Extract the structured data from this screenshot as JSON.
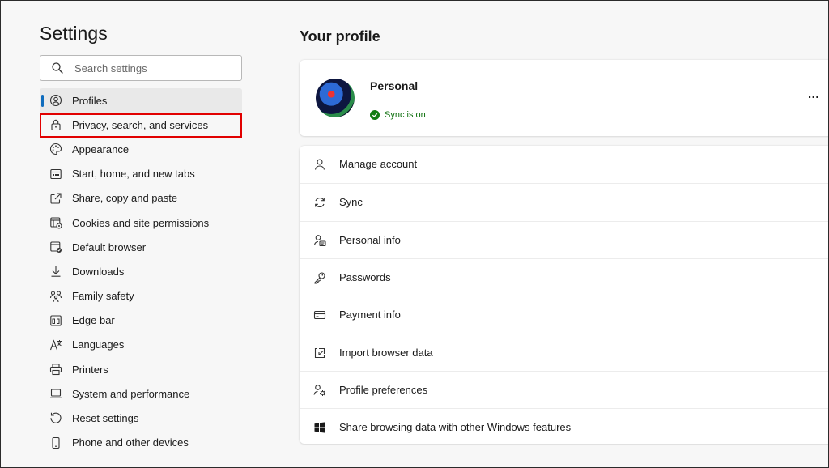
{
  "sidebar": {
    "title": "Settings",
    "search_placeholder": "Search settings",
    "items": [
      {
        "label": "Profiles",
        "icon": "profile-icon"
      },
      {
        "label": "Privacy, search, and services",
        "icon": "lock-icon"
      },
      {
        "label": "Appearance",
        "icon": "palette-icon"
      },
      {
        "label": "Start, home, and new tabs",
        "icon": "window-icon"
      },
      {
        "label": "Share, copy and paste",
        "icon": "share-icon"
      },
      {
        "label": "Cookies and site permissions",
        "icon": "cookie-icon"
      },
      {
        "label": "Default browser",
        "icon": "browser-icon"
      },
      {
        "label": "Downloads",
        "icon": "download-icon"
      },
      {
        "label": "Family safety",
        "icon": "family-icon"
      },
      {
        "label": "Edge bar",
        "icon": "sidebar-panel-icon"
      },
      {
        "label": "Languages",
        "icon": "language-icon"
      },
      {
        "label": "Printers",
        "icon": "printer-icon"
      },
      {
        "label": "System and performance",
        "icon": "laptop-icon"
      },
      {
        "label": "Reset settings",
        "icon": "reset-icon"
      },
      {
        "label": "Phone and other devices",
        "icon": "phone-icon"
      }
    ],
    "active_index": 0
  },
  "main": {
    "title": "Your profile",
    "profile": {
      "name": "Personal",
      "sync_status": "Sync is on",
      "more_label": "..."
    },
    "menu": [
      {
        "label": "Manage account",
        "icon": "person-icon"
      },
      {
        "label": "Sync",
        "icon": "sync-icon"
      },
      {
        "label": "Personal info",
        "icon": "personal-info-icon"
      },
      {
        "label": "Passwords",
        "icon": "key-icon"
      },
      {
        "label": "Payment info",
        "icon": "card-icon"
      },
      {
        "label": "Import browser data",
        "icon": "import-icon"
      },
      {
        "label": "Profile preferences",
        "icon": "profile-preferences-icon"
      },
      {
        "label": "Share browsing data with other Windows features",
        "icon": "windows-icon"
      }
    ]
  },
  "colors": {
    "accent": "#0f6cbd",
    "highlight": "#e10000",
    "sync_green": "#0e700e"
  }
}
